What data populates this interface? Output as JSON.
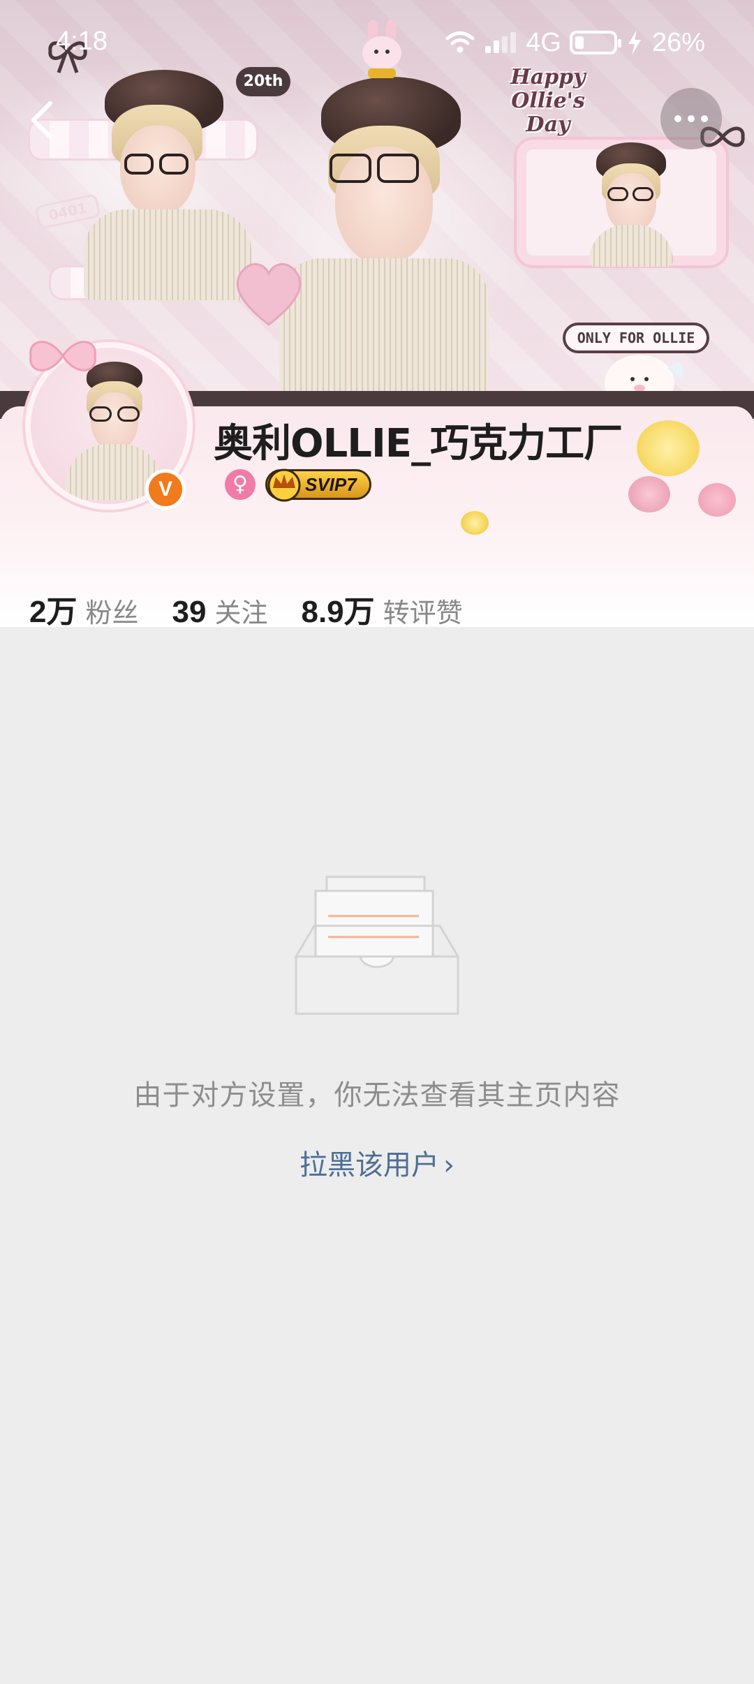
{
  "status_bar": {
    "time": "4:18",
    "network": "4G",
    "battery": "26%"
  },
  "banner": {
    "badge_20th": "20th",
    "happy_text": "Happy Ollie's Day",
    "only_for": "ONLY FOR OLLIE",
    "tag_number": "0401"
  },
  "profile": {
    "username": "奥利OLLIE_巧克力工厂",
    "svip": "SVIP7",
    "verified_mark": "V",
    "gender_symbol": "♀"
  },
  "stats": [
    {
      "value": "2万",
      "label": "粉丝"
    },
    {
      "value": "39",
      "label": "关注"
    },
    {
      "value": "8.9万",
      "label": "转评赞"
    }
  ],
  "empty_state": {
    "message": "由于对方设置，你无法查看其主页内容",
    "block_link": "拉黑该用户",
    "block_chevron": "›"
  },
  "colors": {
    "page_bg": "#ededed",
    "link": "#4e6e95",
    "verified": "#f07a1c",
    "gender": "#f07ba6"
  }
}
